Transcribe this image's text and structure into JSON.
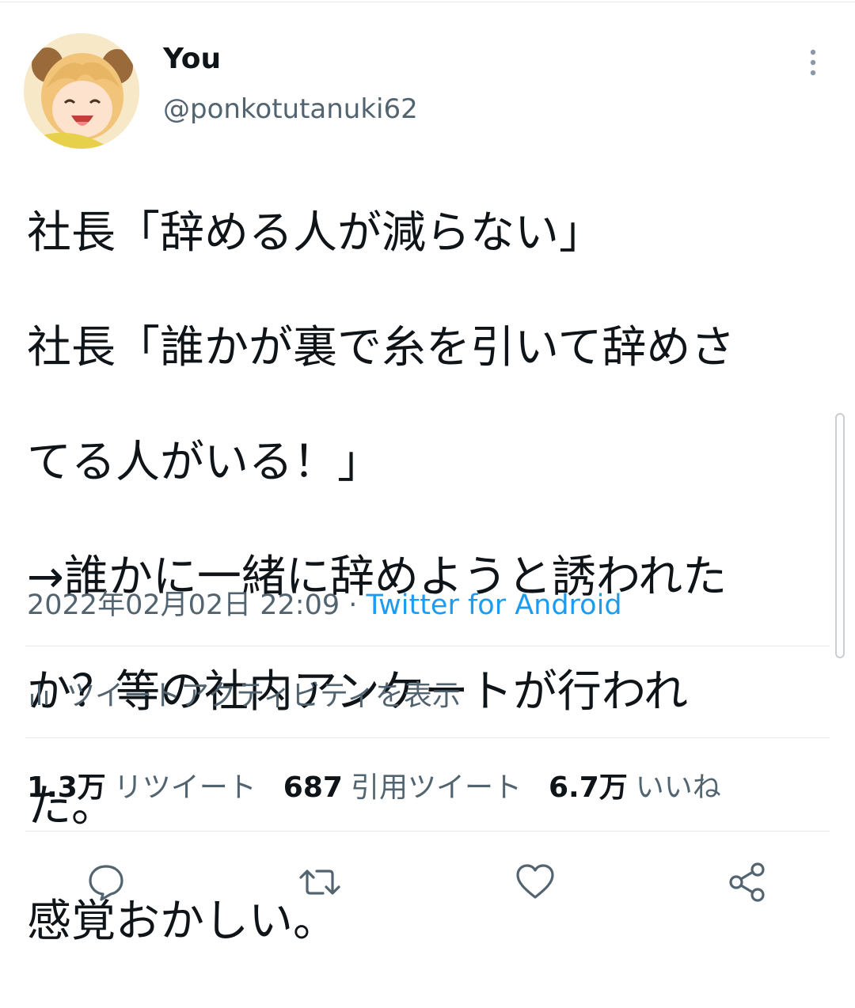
{
  "author": {
    "name": "You",
    "handle": "@ponkotutanuki62"
  },
  "tweet": {
    "lines": [
      "社長「辞める人が減らない」",
      "社長「誰かが裏で糸を引いて辞めさ",
      "てる人がいる！」",
      "→誰かに一緒に辞めようと誘われた",
      "か？等の社内アンケートが行われ",
      "た。",
      "感覚おかしい。"
    ]
  },
  "meta": {
    "timestamp": "2022年02月02日 22:09",
    "separator": " · ",
    "source": "Twitter for Android"
  },
  "activity": {
    "icon": "analytics-icon",
    "label": "ツイートアクティビティを表示"
  },
  "stats": [
    {
      "count": "1.3万",
      "label": "リツイート"
    },
    {
      "count": "687",
      "label": "引用ツイート"
    },
    {
      "count": "6.7万",
      "label": "いいね"
    }
  ],
  "actions": [
    {
      "icon": "reply-icon"
    },
    {
      "icon": "retweet-icon"
    },
    {
      "icon": "like-icon"
    },
    {
      "icon": "share-icon"
    }
  ],
  "colors": {
    "text": "#0f1419",
    "secondary": "#536471",
    "link": "#1d9bf0",
    "divider": "#e6e9eb"
  }
}
